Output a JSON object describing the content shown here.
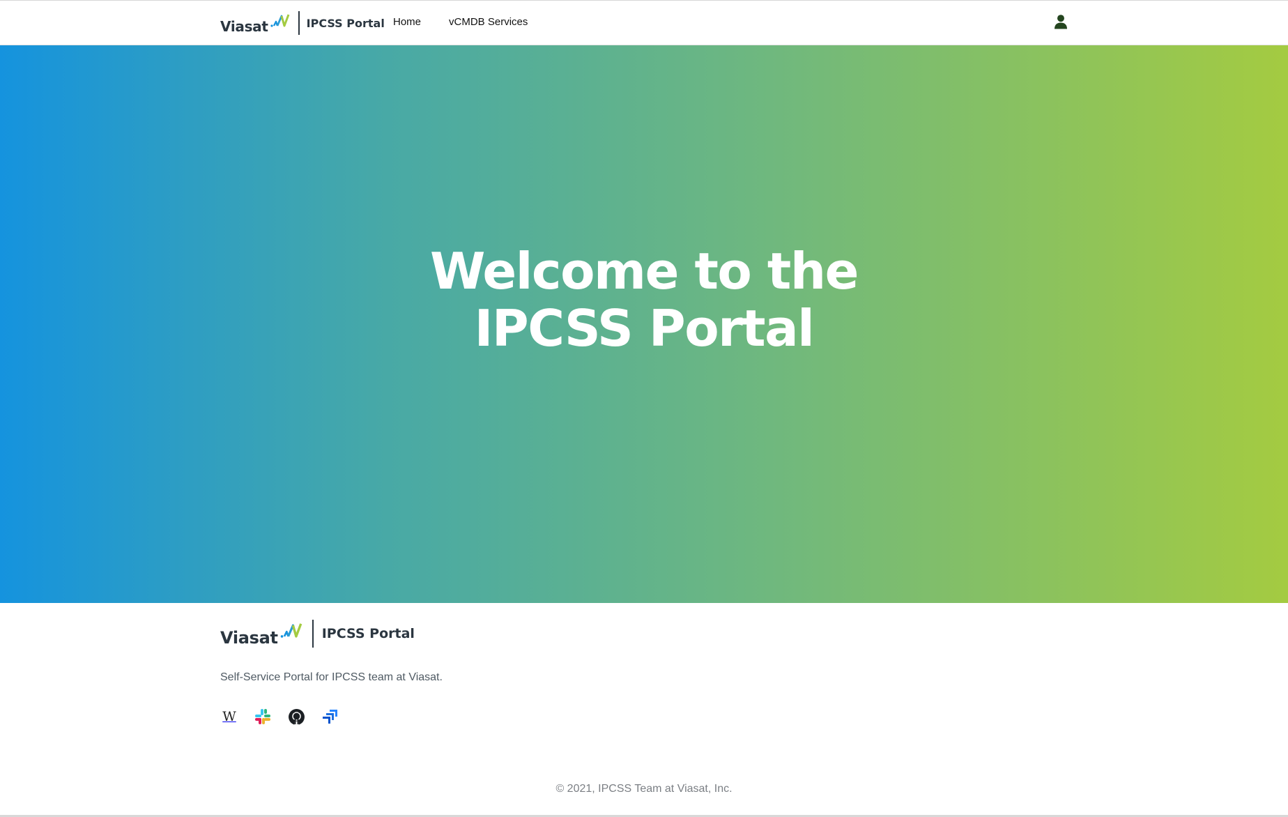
{
  "header": {
    "logo_text": "Viasat",
    "portal_title": "IPCSS Portal",
    "nav": [
      {
        "label": "Home"
      },
      {
        "label": "vCMDB Services"
      }
    ],
    "user_icon": "user-icon"
  },
  "hero": {
    "title": "Welcome to the IPCSS Portal",
    "gradient": [
      "#1593de",
      "#48a9a6",
      "#72b97b",
      "#a4cb41"
    ]
  },
  "footer": {
    "logo_text": "Viasat",
    "portal_title": "IPCSS Portal",
    "tagline": "Self-Service Portal for IPCSS team at Viasat.",
    "social_icons": [
      "wikipedia-icon",
      "slack-icon",
      "github-icon",
      "jira-icon"
    ],
    "copyright": "© 2021, IPCSS Team at Viasat, Inc."
  },
  "colors": {
    "brand_dark": "#2b3640",
    "brand_green": "#a4cb41",
    "brand_blue": "#1593de",
    "user_icon": "#24451f"
  }
}
